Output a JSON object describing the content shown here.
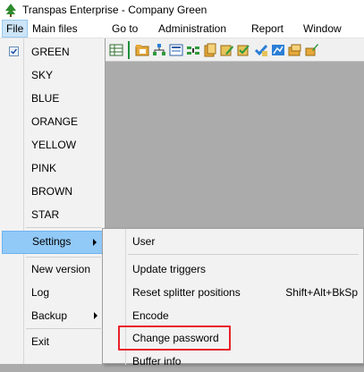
{
  "window": {
    "title": "Transpas Enterprise - Company Green"
  },
  "menubar": {
    "items": [
      {
        "label": "File",
        "active": true
      },
      {
        "label": "Main files"
      },
      {
        "label": "Go to"
      },
      {
        "label": "Administration"
      },
      {
        "label": "Report"
      },
      {
        "label": "Window"
      }
    ]
  },
  "file_menu": {
    "items": [
      {
        "label": "GREEN",
        "checked": true
      },
      {
        "label": "SKY"
      },
      {
        "label": "BLUE"
      },
      {
        "label": "ORANGE"
      },
      {
        "label": "YELLOW"
      },
      {
        "label": "PINK"
      },
      {
        "label": "BROWN"
      },
      {
        "label": "STAR"
      },
      {
        "label": "Settings",
        "active": true,
        "has_submenu": true
      },
      {
        "label": "New version"
      },
      {
        "label": "Log"
      },
      {
        "label": "Backup",
        "has_submenu": true
      },
      {
        "label": "Exit"
      }
    ]
  },
  "settings_menu": {
    "items": [
      {
        "label": "User"
      },
      {
        "label": "Update triggers"
      },
      {
        "label": "Reset splitter positions",
        "shortcut": "Shift+Alt+BkSp"
      },
      {
        "label": "Encode"
      },
      {
        "label": "Change password",
        "highlighted": true
      },
      {
        "label": "Buffer info"
      }
    ]
  },
  "colors": {
    "menu_highlight": "#91c9f7",
    "annotation_red": "#e8202a",
    "workspace": "#ababab",
    "toolbar_separator": "#1c8f3a"
  },
  "toolbar": {
    "icons": [
      "grid-icon",
      "folder-icon",
      "tree-icon",
      "list-icon",
      "split-icon",
      "document-icon",
      "edit-icon",
      "check-edit-icon",
      "check-icon",
      "chart-icon",
      "folder-stack-icon",
      "paint-icon"
    ]
  }
}
